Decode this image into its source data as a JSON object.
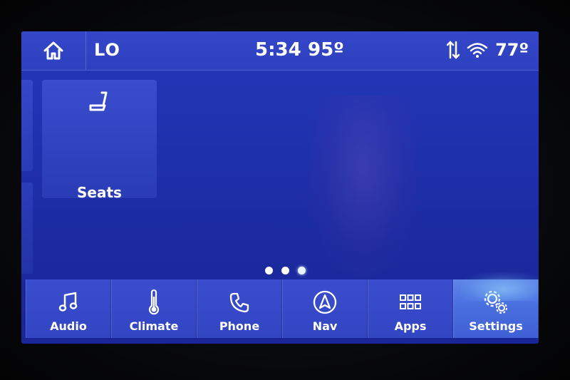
{
  "status_bar": {
    "fan_level": "LO",
    "clock": "5:34",
    "cabin_temp": "95º",
    "outside_temp": "77º",
    "icons": [
      "home-icon",
      "sort-arrows-icon",
      "wifi-icon"
    ]
  },
  "tiles": [
    {
      "label": "Seats",
      "icon": "seat-icon"
    }
  ],
  "pager": {
    "count": 3,
    "active": 2
  },
  "nav": {
    "items": [
      {
        "label": "Audio",
        "icon": "music-note-icon"
      },
      {
        "label": "Climate",
        "icon": "thermometer-icon"
      },
      {
        "label": "Phone",
        "icon": "phone-icon"
      },
      {
        "label": "Nav",
        "icon": "navigation-arrow-icon"
      },
      {
        "label": "Apps",
        "icon": "apps-grid-icon"
      },
      {
        "label": "Settings",
        "icon": "gears-icon"
      }
    ],
    "selected": "Settings"
  },
  "colors": {
    "screen_bg": "#2438b8",
    "tile_bg": "#3a4dcd",
    "selected_tab": "#5f85e8",
    "text": "#ffffff"
  }
}
